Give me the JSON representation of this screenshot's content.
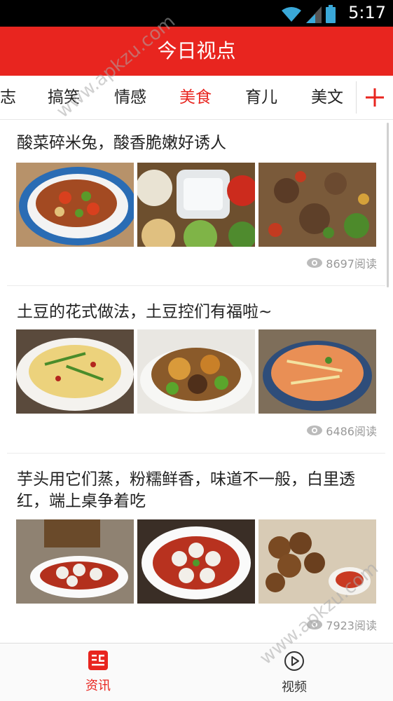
{
  "status_bar": {
    "time": "5:17",
    "icons": [
      "wifi-icon",
      "signal-icon",
      "battery-icon"
    ]
  },
  "app": {
    "title": "今日视点"
  },
  "tabs": [
    {
      "label": "志",
      "active": false
    },
    {
      "label": "搞笑",
      "active": false
    },
    {
      "label": "情感",
      "active": false
    },
    {
      "label": "美食",
      "active": true
    },
    {
      "label": "育儿",
      "active": false
    },
    {
      "label": "美文",
      "active": false
    }
  ],
  "tab_add_icon": "plus-icon",
  "articles": [
    {
      "title": "酸菜碎米兔，酸香脆嫩好诱人",
      "views": "8697阅读"
    },
    {
      "title": "土豆的花式做法，土豆控们有福啦~",
      "views": "6486阅读"
    },
    {
      "title": "芋头用它们蒸，粉糯鲜香，味道不一般，白里透红，端上桌争着吃",
      "views": "7923阅读"
    }
  ],
  "bottom_nav": {
    "news": {
      "label": "资讯",
      "icon": "news-icon",
      "active": true
    },
    "video": {
      "label": "视频",
      "icon": "play-circle-icon",
      "active": false
    }
  },
  "watermark": "www.apkzu.com",
  "colors": {
    "brand_red": "#e8251f",
    "text": "#222222",
    "muted": "#999999"
  }
}
